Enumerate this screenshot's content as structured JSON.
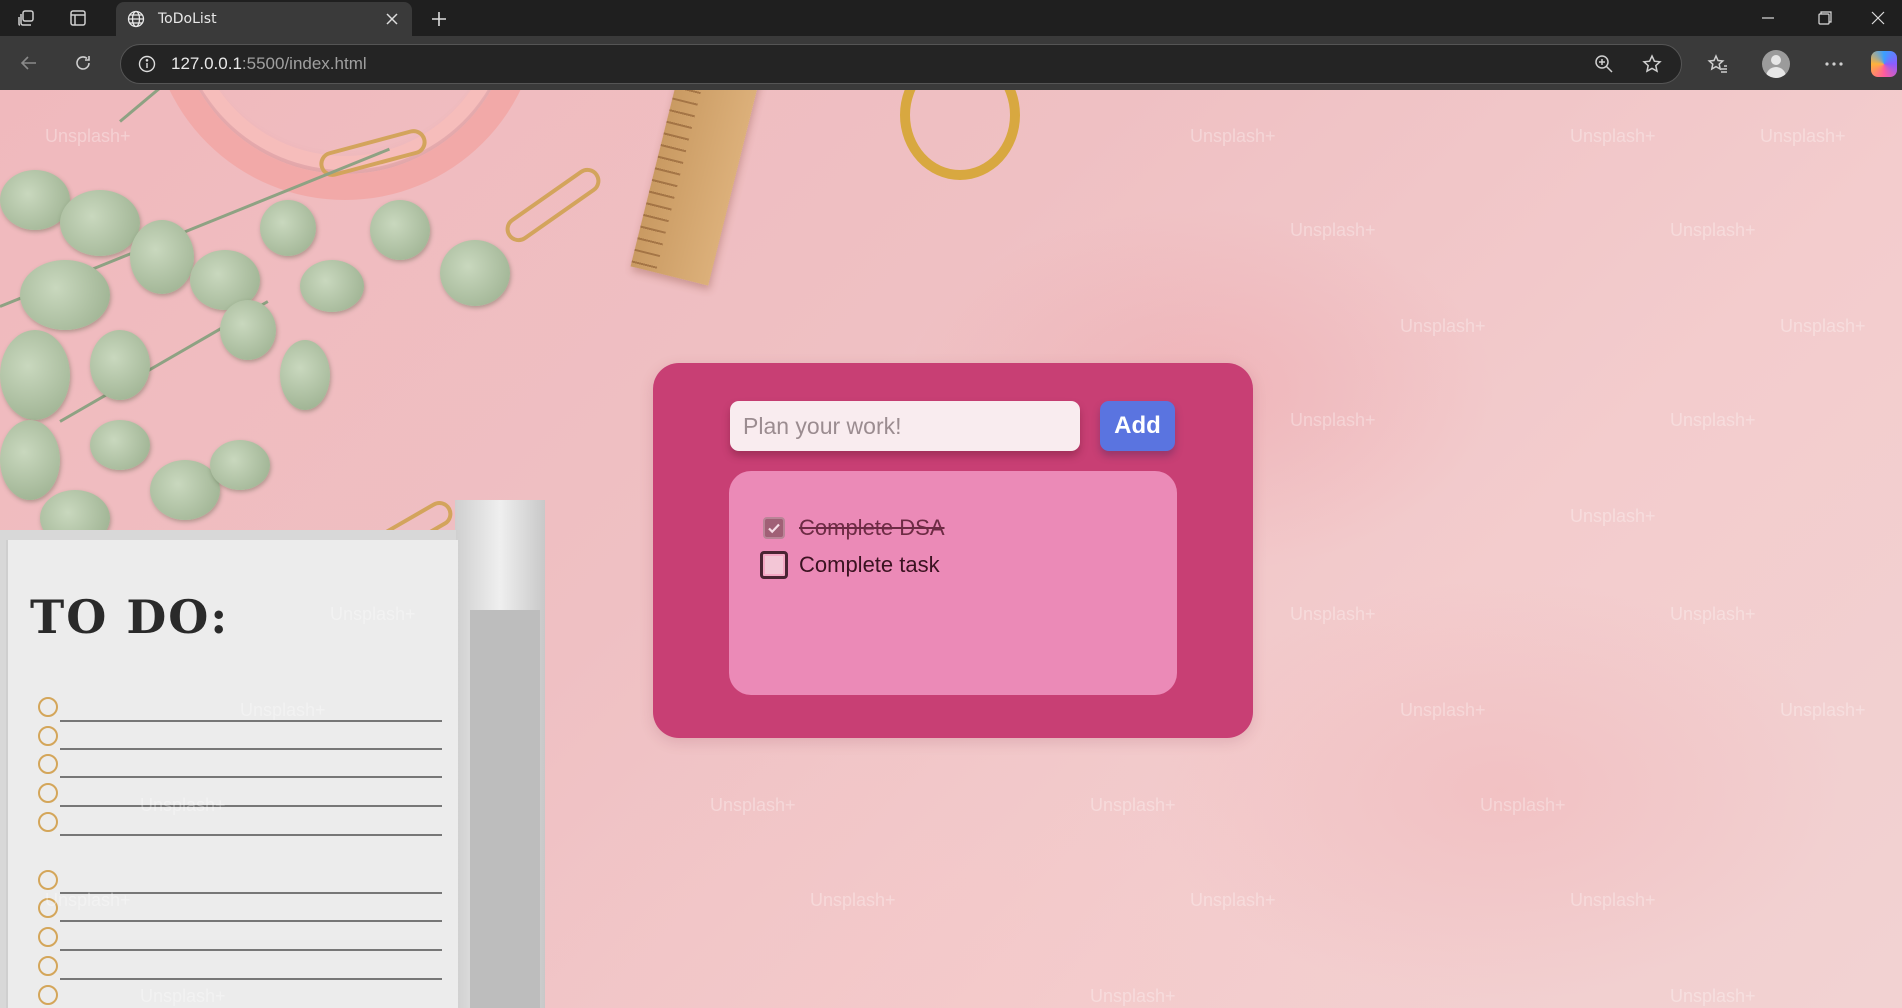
{
  "browser": {
    "tab_title": "ToDoList",
    "url_host": "127.0.0.1",
    "url_rest": ":5500/index.html"
  },
  "watermark_text": "Unsplash+",
  "background_note": {
    "todo_heading": "TO DO:"
  },
  "app": {
    "input_placeholder": "Plan your work!",
    "input_value": "",
    "add_label": "Add",
    "tasks": [
      {
        "label": "Complete DSA",
        "done": true
      },
      {
        "label": "Complete task",
        "done": false
      }
    ]
  },
  "colors": {
    "card": "#c83f74",
    "list_panel": "#eb8ab7",
    "add_button": "#5a74e0",
    "input_bg": "#f9ecef"
  }
}
